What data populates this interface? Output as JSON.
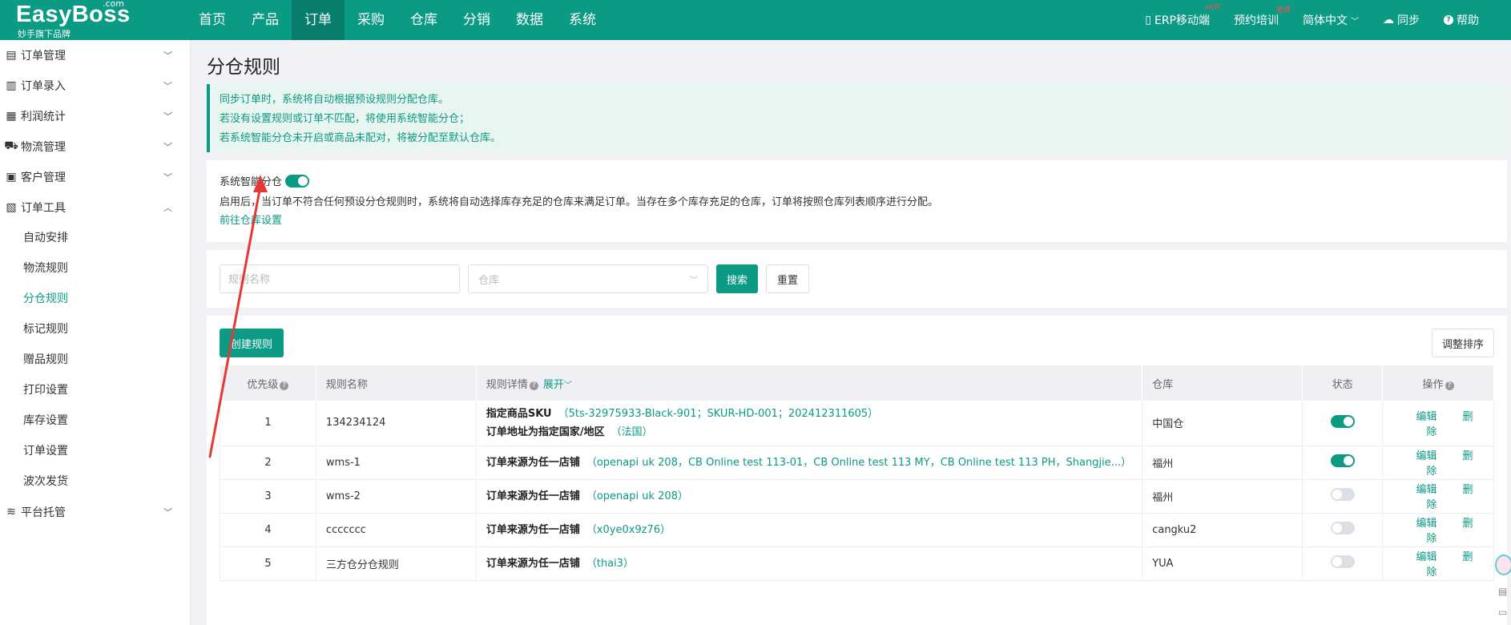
{
  "brand": {
    "name": "EasyBoss",
    "com": ".com",
    "sub": "妙手旗下品牌"
  },
  "nav": [
    {
      "label": "首页",
      "active": false
    },
    {
      "label": "产品",
      "active": false
    },
    {
      "label": "订单",
      "active": true
    },
    {
      "label": "采购",
      "active": false
    },
    {
      "label": "仓库",
      "active": false
    },
    {
      "label": "分销",
      "active": false
    },
    {
      "label": "数据",
      "active": false
    },
    {
      "label": "系统",
      "active": false
    }
  ],
  "header_right": {
    "erp": "ERP移动端",
    "erp_badge": "HOT",
    "training": "预约培训",
    "training_badge": "免费",
    "language": "简体中文",
    "sync": "同步",
    "help": "帮助"
  },
  "sidebar": {
    "groups": [
      {
        "label": "订单管理",
        "icon": "order-manage-icon"
      },
      {
        "label": "订单录入",
        "icon": "order-entry-icon"
      },
      {
        "label": "利润统计",
        "icon": "profit-icon"
      },
      {
        "label": "物流管理",
        "icon": "truck-icon"
      },
      {
        "label": "客户管理",
        "icon": "customer-icon"
      },
      {
        "label": "订单工具",
        "icon": "tools-icon"
      }
    ],
    "tool_items": [
      "自动安排",
      "物流规则",
      "分仓规则",
      "标记规则",
      "赠品规则",
      "打印设置",
      "库存设置",
      "订单设置",
      "波次发货"
    ],
    "active_item": "分仓规则",
    "last_group": {
      "label": "平台托管",
      "icon": "platform-icon"
    }
  },
  "page": {
    "title": "分仓规则",
    "notice": [
      "同步订单时，系统将自动根据预设规则分配仓库。",
      "若没有设置规则或订单不匹配，将使用系统智能分仓；",
      "若系统智能分仓未开启或商品未配对，将被分配至默认仓库。"
    ],
    "smart": {
      "label": "系统智能分仓",
      "enabled": true,
      "desc": "启用后，当订单不符合任何预设分仓规则时，系统将自动选择库存充足的仓库来满足订单。当存在多个库存充足的仓库，订单将按照仓库列表顺序进行分配。",
      "link": "前往仓库设置"
    },
    "filter": {
      "name_placeholder": "规则名称",
      "warehouse_placeholder": "仓库",
      "search": "搜索",
      "reset": "重置"
    },
    "create_btn": "创建规则",
    "sort_btn": "调整排序"
  },
  "table": {
    "headers": {
      "priority": "优先级",
      "name": "规则名称",
      "detail": "规则详情",
      "expand": "展开",
      "warehouse": "仓库",
      "status": "状态",
      "ops": "操作"
    },
    "edit": "编辑",
    "delete": "删除",
    "rows": [
      {
        "priority": "1",
        "name": "134234124",
        "details": [
          {
            "key": "指定商品SKU",
            "val": "（5ts-32975933-Black-901；SKUR-HD-001；202412311605）"
          },
          {
            "key": "订单地址为指定国家/地区",
            "val": "（法国）"
          }
        ],
        "warehouse": "中国仓",
        "enabled": true
      },
      {
        "priority": "2",
        "name": "wms-1",
        "details": [
          {
            "key": "订单来源为任一店铺",
            "val": "（openapi uk 208，CB Online test 113-01，CB Online test 113 MY，CB Online test 113 PH，Shangjie...）"
          }
        ],
        "warehouse": "福州",
        "enabled": true
      },
      {
        "priority": "3",
        "name": "wms-2",
        "details": [
          {
            "key": "订单来源为任一店铺",
            "val": "（openapi uk 208）"
          }
        ],
        "warehouse": "福州",
        "enabled": false
      },
      {
        "priority": "4",
        "name": "ccccccc",
        "details": [
          {
            "key": "订单来源为任一店铺",
            "val": "（x0ye0x9z76）"
          }
        ],
        "warehouse": "cangku2",
        "enabled": false
      },
      {
        "priority": "5",
        "name": "三方仓分仓规则",
        "details": [
          {
            "key": "订单来源为任一店铺",
            "val": "（thai3）"
          }
        ],
        "warehouse": "YUA",
        "enabled": false
      }
    ]
  },
  "colors": {
    "primary": "#0b9a84",
    "annotation": "#e53935"
  }
}
